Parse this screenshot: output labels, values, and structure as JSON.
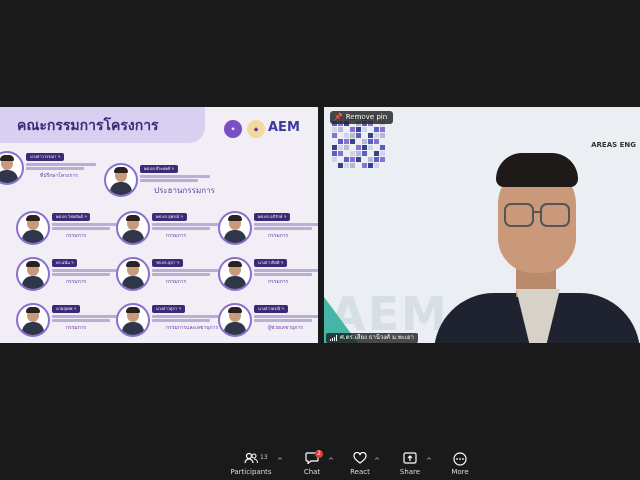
{
  "share": {
    "title": "คณะกรรมการโครงการ",
    "logos": [
      "logo-1",
      "logo-2"
    ],
    "aem_logo": "AEM",
    "people": [
      {
        "name": "นางสาววรรณา ฯ",
        "role": "ที่ปรึกษาโครงการ"
      },
      {
        "name": "ผศ.ดร.ธีระพงศ์ ฯ",
        "role": "ประธานกรรมการ"
      },
      {
        "name": "ผศ.ดร.ไชยยันต์ ฯ",
        "role": "กรรมการ"
      },
      {
        "name": "ผศ.ดร.สุพรณ์ ฯ",
        "role": "กรรมการ"
      },
      {
        "name": "ผศ.ดร.อภิรักษ์ ฯ",
        "role": "กรรมการ"
      },
      {
        "name": "ดร.อนิน ฯ",
        "role": "กรรมการ"
      },
      {
        "name": "รศ.ดร.สุภา ฯ",
        "role": "กรรมการ"
      },
      {
        "name": "นางสาวกิตติ ฯ",
        "role": "กรรมการ"
      },
      {
        "name": "นายสุเทพ ฯ",
        "role": "กรรมการ"
      },
      {
        "name": "นางสาวสุภา ฯ",
        "role": "กรรมการและเลขานุการ"
      },
      {
        "name": "นางสาวอรณี ฯ",
        "role": "ผู้ช่วยเลขานุการ"
      }
    ]
  },
  "speaker": {
    "remove_pin": "Remove pin",
    "areas_text": "AREAS ENG",
    "watermark": "AEM",
    "name": "ศ.ดร.เสียง ธานีวงศ์ ม.พะเยา"
  },
  "toolbar": {
    "participants_label": "Participants",
    "participants_count": "13",
    "chat_label": "Chat",
    "chat_badge": "2",
    "react_label": "React",
    "share_label": "Share",
    "more_label": "More",
    "icons": {
      "participants": "people-icon",
      "chat": "chat-icon",
      "react": "heart-icon",
      "share": "share-icon",
      "more": "more-icon"
    }
  }
}
